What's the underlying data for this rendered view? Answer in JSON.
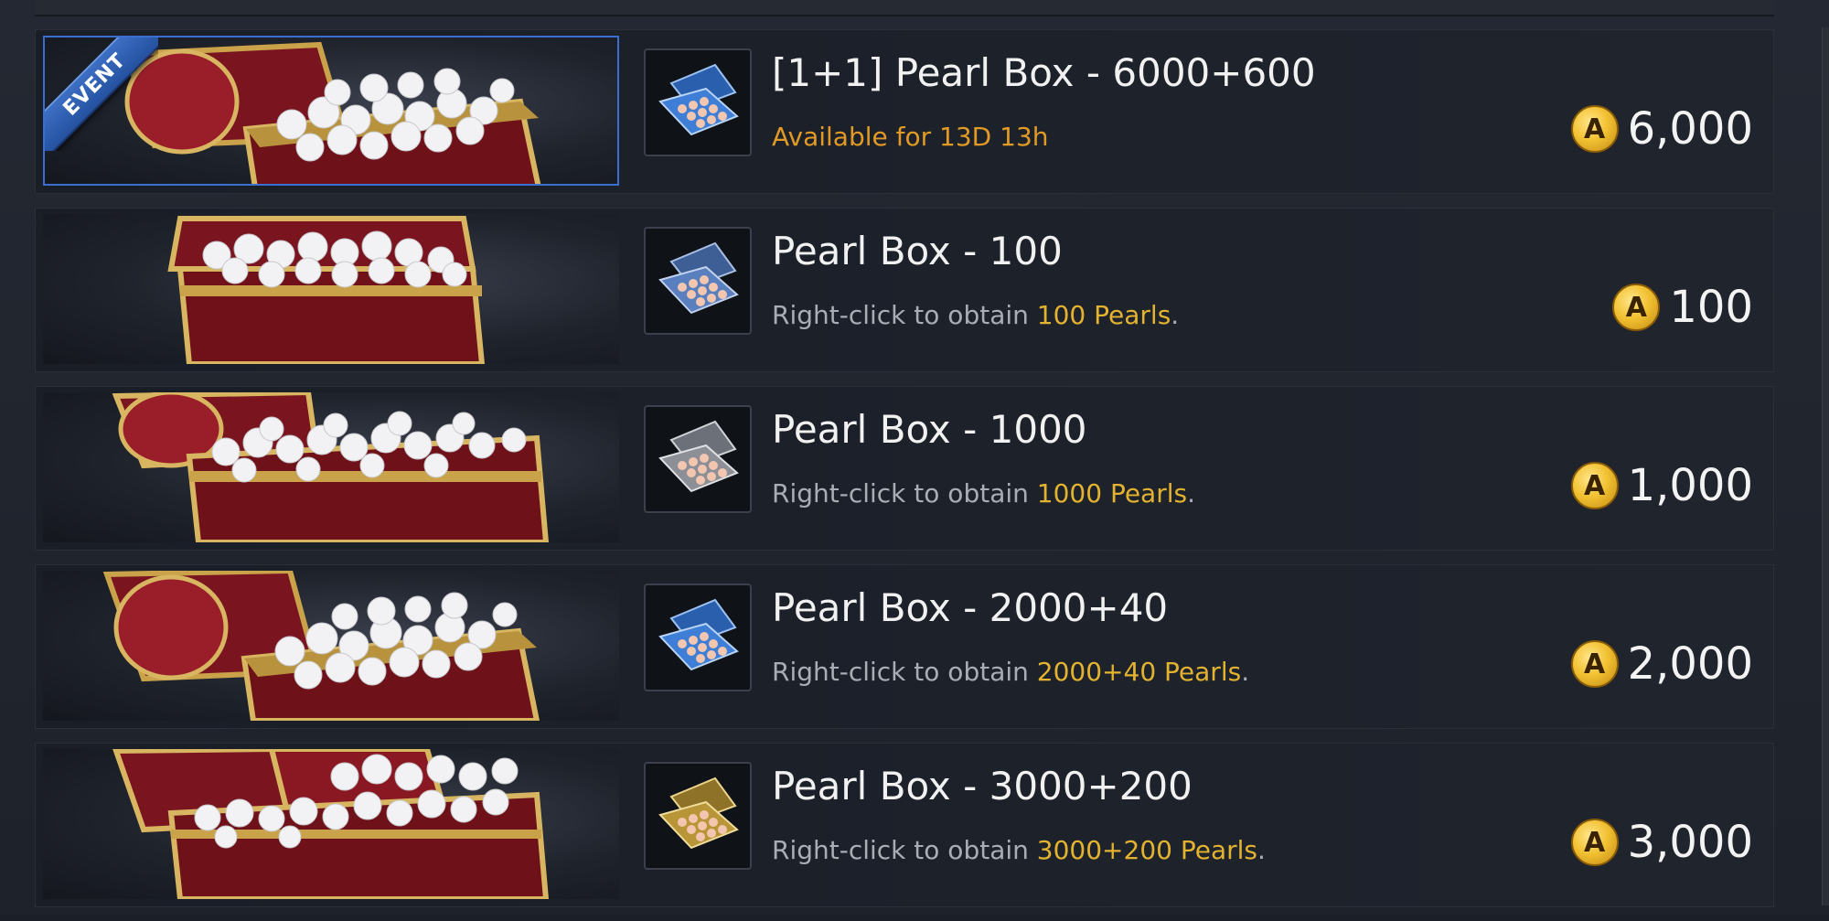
{
  "shop": {
    "items": [
      {
        "ribbon": "EVENT",
        "title": "[1+1] Pearl Box - 6000+600",
        "subtitle_plain": "Available for 13D 13h",
        "price": "6,000",
        "coin_glyph": "A",
        "box_color": "#3f7ed6",
        "banner_icon": "open-pearl-chest-icon",
        "item_icon": "pearl-box-blue-icon"
      },
      {
        "title": "Pearl Box - 100",
        "subtitle_prefix": "Right-click to obtain ",
        "subtitle_highlight": "100 Pearls",
        "subtitle_suffix": ".",
        "price": "100",
        "coin_glyph": "A",
        "box_color": "#5a7fbf",
        "banner_icon": "pearl-chest-icon",
        "item_icon": "pearl-box-steel-blue-icon"
      },
      {
        "title": "Pearl Box - 1000",
        "subtitle_prefix": "Right-click to obtain ",
        "subtitle_highlight": "1000 Pearls",
        "subtitle_suffix": ".",
        "price": "1,000",
        "coin_glyph": "A",
        "box_color": "#8c8f96",
        "banner_icon": "open-pearl-chest-icon",
        "item_icon": "pearl-box-silver-icon"
      },
      {
        "title": "Pearl Box - 2000+40",
        "subtitle_prefix": "Right-click to obtain ",
        "subtitle_highlight": "2000+40 Pearls",
        "subtitle_suffix": ".",
        "price": "2,000",
        "coin_glyph": "A",
        "box_color": "#3f7ed6",
        "banner_icon": "open-pearl-chest-icon",
        "item_icon": "pearl-box-blue-icon"
      },
      {
        "title": "Pearl Box - 3000+200",
        "subtitle_prefix": "Right-click to obtain ",
        "subtitle_highlight": "3000+200 Pearls",
        "subtitle_suffix": ".",
        "price": "3,000",
        "coin_glyph": "A",
        "box_color": "#b89638",
        "banner_icon": "double-pearl-chest-icon",
        "item_icon": "pearl-box-gold-icon"
      }
    ]
  },
  "colors": {
    "highlight": "#e3b330",
    "availability": "#e09a25",
    "event_ribbon": "#2f5fb3"
  }
}
